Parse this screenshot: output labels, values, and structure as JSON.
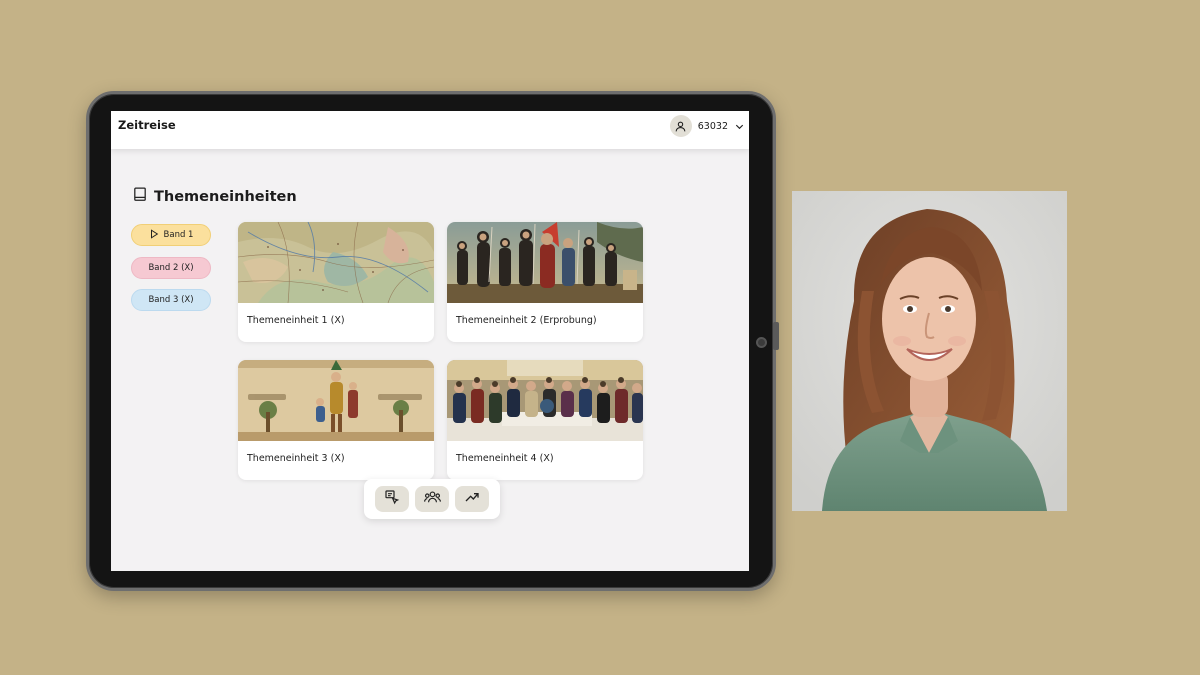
{
  "app": {
    "title": "Zeitreise"
  },
  "user": {
    "id": "63032",
    "avatar_icon": "user-icon",
    "menu_icon": "chevron-down-icon"
  },
  "page": {
    "title": "Themeneinheiten",
    "icon": "book-icon"
  },
  "bands": [
    {
      "label": "Band 1",
      "icon": "play-icon",
      "color": "#fbe09d",
      "selected": true
    },
    {
      "label": "Band 2 (X)",
      "color": "#f6c9d2",
      "selected": false
    },
    {
      "label": "Band 3 (X)",
      "color": "#cfe6f5",
      "selected": false
    }
  ],
  "units": [
    {
      "label": "Themeneinheit 1 (X)",
      "image": "historical-map-image"
    },
    {
      "label": "Themeneinheit 2 (Erprobung)",
      "image": "conquistadors-painting-image"
    },
    {
      "label": "Themeneinheit 3 (X)",
      "image": "freiheit-gleichheit-illustration-image"
    },
    {
      "label": "Themeneinheit 4 (X)",
      "image": "congress-assembly-painting-image"
    }
  ],
  "toolbar": {
    "tools": [
      {
        "icon": "presentation-icon"
      },
      {
        "icon": "group-icon"
      },
      {
        "icon": "trend-up-icon"
      }
    ]
  },
  "colors": {
    "background": "#c4b287",
    "screen": "#f3f2f3",
    "accent": "#e4e1d8"
  }
}
